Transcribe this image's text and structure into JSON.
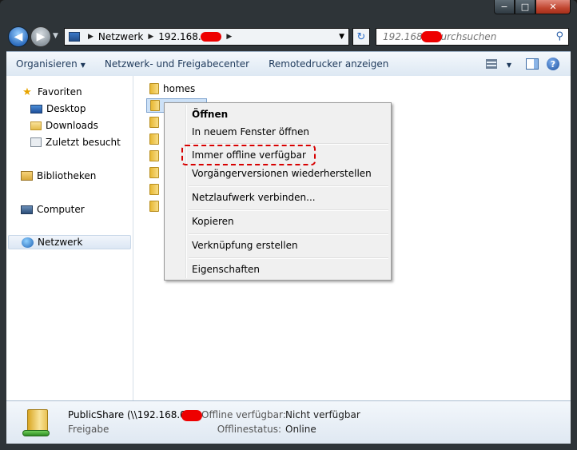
{
  "window": {
    "caption": {
      "minimize": "−",
      "maximize": "□",
      "close": "✕"
    }
  },
  "address": {
    "segments": [
      "Netzwerk",
      "192.168.0"
    ],
    "search_placeholder": "192.168.0 durchsuchen"
  },
  "toolbar": {
    "organize": "Organisieren",
    "network_center": "Netzwerk- und Freigabecenter",
    "remote_printers": "Remotedrucker anzeigen"
  },
  "nav": {
    "favorites": "Favoriten",
    "desktop": "Desktop",
    "downloads": "Downloads",
    "recent": "Zuletzt besucht",
    "libraries": "Bibliotheken",
    "computer": "Computer",
    "network": "Netzwerk"
  },
  "files": {
    "homes": "homes"
  },
  "context_menu": {
    "open": "Öffnen",
    "open_new_window": "In neuem Fenster öffnen",
    "always_offline": "Immer offline verfügbar",
    "restore_versions": "Vorgängerversionen wiederherstellen",
    "map_drive": "Netzlaufwerk verbinden...",
    "copy": "Kopieren",
    "create_shortcut": "Verknüpfung erstellen",
    "properties": "Eigenschaften"
  },
  "details": {
    "name": "PublicShare (\\\\192.168.0",
    "type": "Freigabe",
    "offline_available_label": "Offline verfügbar:",
    "offline_available_value": "Nicht verfügbar",
    "offline_status_label": "Offlinestatus:",
    "offline_status_value": "Online"
  },
  "colors": {
    "accent_text": "#1e395b",
    "highlight_annotation": "#d70000"
  }
}
